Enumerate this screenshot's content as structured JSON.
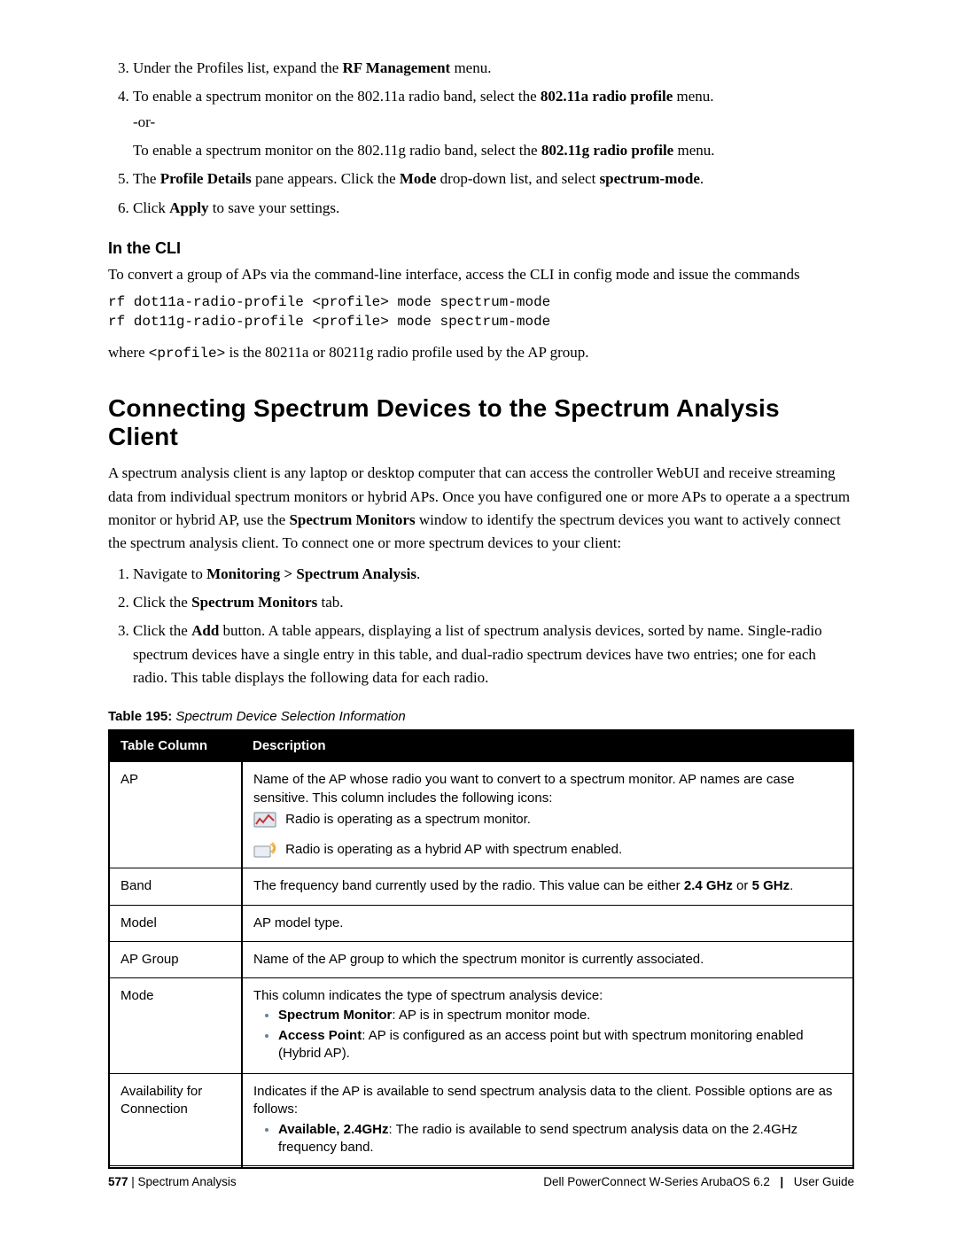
{
  "steps_top": {
    "s3_a": "Under the Profiles list, expand the ",
    "s3_b": "RF Management",
    "s3_c": " menu.",
    "s4_a": "To enable a spectrum monitor on the 802.11a radio band, select the ",
    "s4_b": "802.11a radio profile",
    "s4_c": " menu.",
    "s4_or": "-or-",
    "s4_d": "To enable a spectrum monitor on the 802.11g radio band, select the ",
    "s4_e": "802.11g radio profile",
    "s4_f": " menu.",
    "s5_a": "The ",
    "s5_b": "Profile Details",
    "s5_c": " pane appears. Click the ",
    "s5_d": "Mode",
    "s5_e": " drop-down list, and select ",
    "s5_f": "spectrum-mode",
    "s5_g": ".",
    "s6_a": "Click ",
    "s6_b": "Apply",
    "s6_c": " to save your settings."
  },
  "cli": {
    "heading": "In the CLI",
    "intro": "To convert a group of APs via the command-line interface, access the CLI in config mode and issue the commands",
    "code": "rf dot11a-radio-profile <profile> mode spectrum-mode\nrf dot11g-radio-profile <profile> mode spectrum-mode",
    "where_a": "where ",
    "where_b": "<profile>",
    "where_c": " is the 80211a or 80211g radio profile used by the AP group."
  },
  "section": {
    "title": "Connecting Spectrum Devices to the Spectrum Analysis Client",
    "p_a": "A spectrum analysis client is any laptop or desktop computer that can access the controller WebUI and receive streaming data from individual spectrum monitors or hybrid APs. Once you have configured one or more APs to operate a a spectrum monitor or hybrid AP, use the ",
    "p_b": "Spectrum Monitors",
    "p_c": " window to identify the spectrum devices you want to actively connect the spectrum analysis client. To connect one or more spectrum devices to your client:"
  },
  "steps_section": {
    "s1_a": "Navigate to ",
    "s1_b": "Monitoring > Spectrum Analysis",
    "s1_c": ".",
    "s2_a": "Click the ",
    "s2_b": "Spectrum Monitors",
    "s2_c": " tab.",
    "s3_a": "Click the ",
    "s3_b": "Add",
    "s3_c": " button. A table appears, displaying a list of spectrum analysis devices, sorted by name. Single-radio spectrum devices have a single entry in this table, and dual-radio spectrum devices have two entries; one for each radio. This table displays the following data for each radio."
  },
  "table_caption": {
    "label": "Table 195:",
    "title": " Spectrum Device Selection Information"
  },
  "table": {
    "h1": "Table Column",
    "h2": "Description",
    "r1c1": "AP",
    "r1_l1": "Name of the AP whose radio you want to convert to a spectrum monitor. AP names are case sensitive. This column includes the following icons:",
    "r1_l2": "Radio is operating as a spectrum monitor.",
    "r1_l3": "Radio is operating as a hybrid AP with spectrum enabled.",
    "r2c1": "Band",
    "r2_a": "The frequency band currently used by the radio. This value can be either ",
    "r2_b": "2.4 GHz",
    "r2_c": " or ",
    "r2_d": "5 GHz",
    "r2_e": ".",
    "r3c1": "Model",
    "r3c2": "AP model type.",
    "r4c1": "AP Group",
    "r4c2": "Name of the AP group to which the spectrum monitor is currently associated.",
    "r5c1": "Mode",
    "r5_l1": "This column indicates the type of spectrum analysis device:",
    "r5_li1_b": "Spectrum Monitor",
    "r5_li1_t": ": AP is in spectrum monitor mode.",
    "r5_li2_b": "Access Point",
    "r5_li2_t": ": AP is configured as an access point but with spectrum monitoring enabled (Hybrid AP).",
    "r6c1": "Availability for Connection",
    "r6_l1": "Indicates if the AP is available to send spectrum analysis data to the client. Possible options are as follows:",
    "r6_li1_b": "Available, 2.4GHz",
    "r6_li1_t": ": The radio is available to send spectrum analysis data on the 2.4GHz frequency band."
  },
  "footer": {
    "page": "577",
    "bar": " | ",
    "chapter": "Spectrum Analysis",
    "product": "Dell PowerConnect W-Series ArubaOS 6.2",
    "sep": "|",
    "guide": "User Guide"
  }
}
